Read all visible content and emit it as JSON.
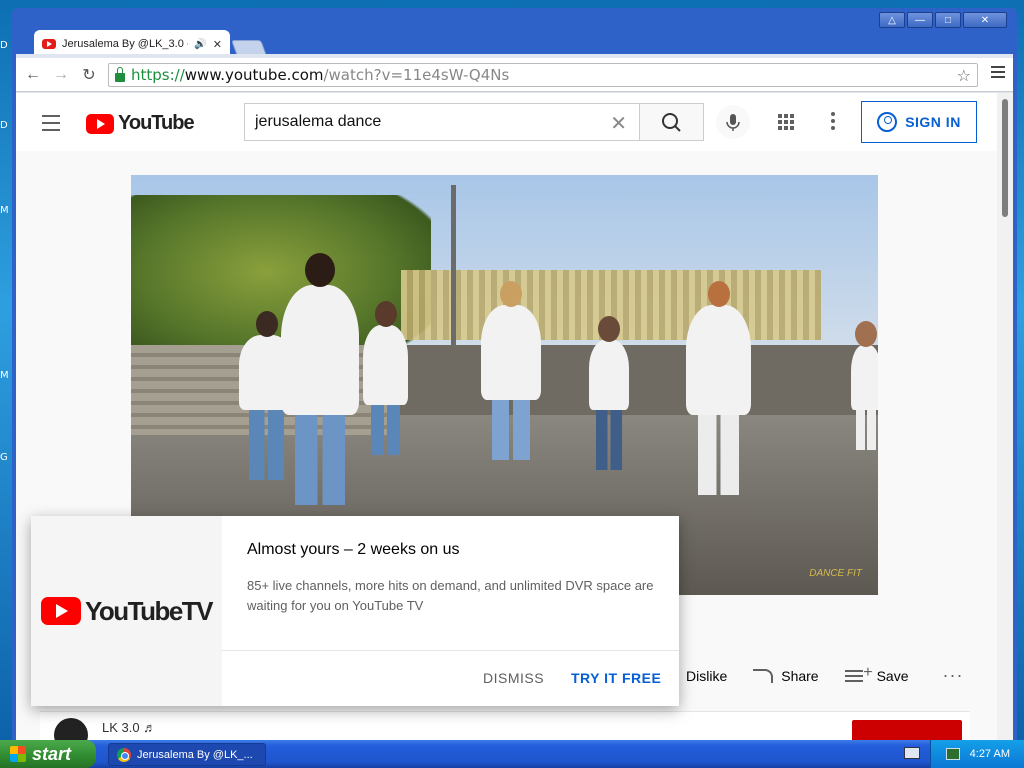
{
  "desktop": {
    "edge_letters": [
      "D",
      "M",
      "M",
      "G"
    ]
  },
  "window": {
    "controls": {
      "profile": "△",
      "minimize": "—",
      "maximize": "□",
      "close": "✕"
    }
  },
  "tab": {
    "title": "Jerusalema By @LK_3.0 -",
    "audio_icon": "🔊",
    "close": "✕"
  },
  "toolbar": {
    "back": "←",
    "forward": "→",
    "reload": "↻",
    "url": {
      "scheme": "https://",
      "host": "www.youtube.com",
      "path": "/watch?v=11e4sW-Q4Ns"
    },
    "star": "☆"
  },
  "youtube": {
    "logo_text": "YouTube",
    "search": {
      "value": "jerusalema dance",
      "clear": "✕"
    },
    "signin_label": "SIGN IN"
  },
  "video": {
    "watermark": "DANCE FIT"
  },
  "actions": {
    "dislike": "Dislike",
    "share": "Share",
    "save": "Save",
    "more": "···"
  },
  "channel": {
    "name": "LK 3.0 ♬"
  },
  "promo": {
    "logo_text": "YouTubeTV",
    "title": "Almost yours – 2 weeks on us",
    "body": "85+ live channels, more hits on demand, and unlimited DVR space are waiting for you on YouTube TV",
    "dismiss": "DISMISS",
    "try_free": "TRY IT FREE"
  },
  "taskbar": {
    "start_label": "start",
    "task_title": "Jerusalema By @LK_...",
    "clock": "4:27 AM"
  },
  "colors": {
    "youtube_red": "#ff0000",
    "link_blue": "#065fd4",
    "xp_blue": "#245edb",
    "start_green": "#3c9a3c"
  }
}
